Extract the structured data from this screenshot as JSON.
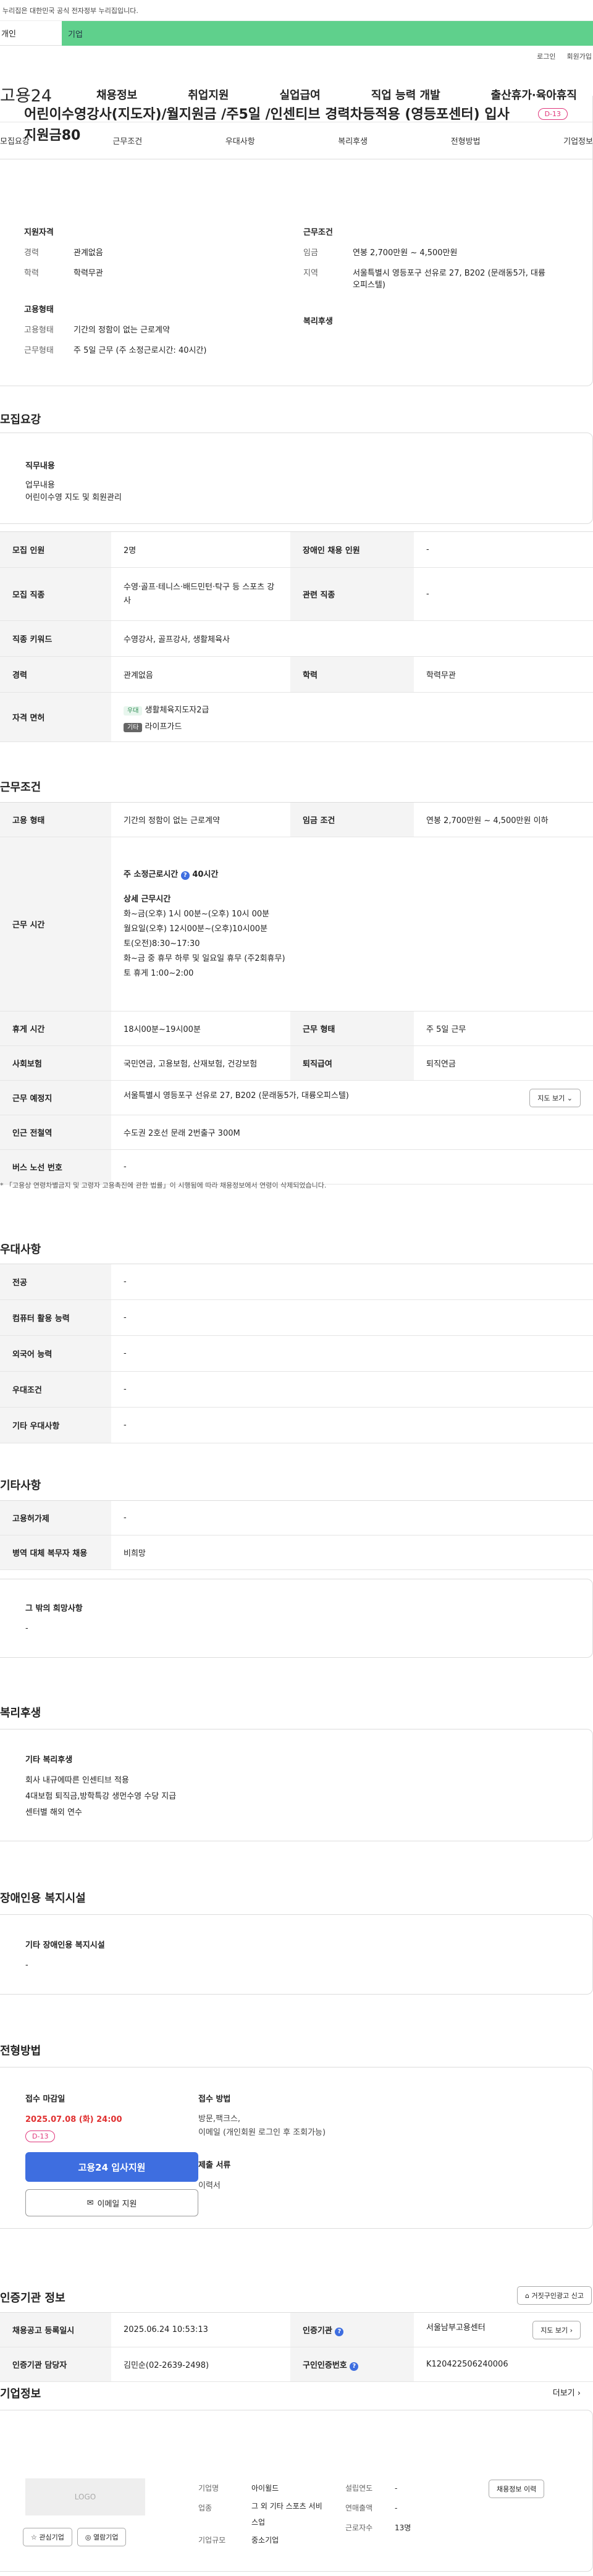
{
  "banner": "이 누리집은 대한민국 공식 전자정부 누리집입니다.",
  "banner_shown": "누리집은 대한민국 공식 전자정부 누리집입니다.",
  "topbar": {
    "tab1": "개인",
    "tab2": "기업"
  },
  "util": {
    "login": "로그인",
    "signup": "회원가입"
  },
  "gnb": {
    "logo": "고용24",
    "menus": [
      "채용정보",
      "취업지원",
      "실업급여",
      "직업 능력 개발",
      "출산휴가·육아휴직"
    ]
  },
  "tabs": [
    "모집요강",
    "근무조건",
    "우대사항",
    "복리후생",
    "전형방법",
    "기업정보"
  ],
  "header": {
    "title": "어린이수영강사(지도자)/월지원금 /주5일 /인센티브 경력차등적용 (영등포센터) 입사지원금80",
    "dday": "D-13",
    "left_h1": "지원자격",
    "career_k": "경력",
    "career_v": "관계없음",
    "edu_k": "학력",
    "edu_v": "학력무관",
    "left_h2": "고용형태",
    "emp_k": "고용형태",
    "emp_v": "기간의 정함이 없는 근로계약",
    "work_k": "근무형태",
    "work_v": "주 5일 근무 (주 소정근로시간: 40시간)",
    "right_h1": "근무조건",
    "wage_k": "임금",
    "wage_v": "연봉 2,700만원 ~ 4,500만원",
    "loc_k": "지역",
    "loc_v": "서울특별시 영등포구 선유로 27, B202 (문래동5가, 대륭오피스텔)",
    "right_h2": "복리후생"
  },
  "recruit": {
    "heading": "모집요강",
    "duty_h": "직무내용",
    "duty_lines": [
      "업무내용",
      "어린이수영 지도 및 회원관리"
    ],
    "rows": [
      {
        "k": "모집 인원",
        "v": "2명",
        "k2": "장애인 채용 인원",
        "v2": "-"
      },
      {
        "k": "모집 직종",
        "v": "수영·골프·테니스·배드민턴·탁구 등 스포츠 강사",
        "k2": "관련 직종",
        "v2": "-"
      },
      {
        "k": "직종 키워드",
        "v": "수영강사, 골프강사, 생활체육사"
      },
      {
        "k": "경력",
        "v": "관계없음",
        "k2": "학력",
        "v2": "학력무관"
      }
    ],
    "license_k": "자격 면허",
    "lic1_tag": "우대",
    "lic1": "생활체육지도자2급",
    "lic2_tag": "기타",
    "lic2": "라이프가드"
  },
  "cond": {
    "heading": "근무조건",
    "emp_k": "고용 형태",
    "emp_v": "기간의 정함이 없는 근로계약",
    "wage_k": "임금 조건",
    "wage_v": "연봉 2,700만원 ~ 4,500만원 이하",
    "time_k": "근무 시간",
    "time_week": "주 소정근로시간",
    "time_week_v": "40시간",
    "time_detail_h": "상세 근무시간",
    "time_lines": [
      "화~금(오후) 1시 00분~(오후) 10시 00분",
      "월요일(오후) 12시00분~(오후)10시00분",
      "토(오전)8:30~17:30",
      "화~금 중 휴무 하루 및 일요일 휴무 (주2회휴무)",
      "토 휴게  1:00~2:00"
    ],
    "break_k": "휴게 시간",
    "break_v": "18시00분~19시00분",
    "form_k": "근무 형태",
    "form_v": "주 5일 근무",
    "ins_k": "사회보험",
    "ins_v": "국민연금, 고용보험, 산재보험, 건강보험",
    "ret_k": "퇴직급여",
    "ret_v": "퇴직연금",
    "place_k": "근무 예정지",
    "place_v": "서울특별시 영등포구 선유로 27, B202 (문래동5가, 대륭오피스텔)",
    "map_btn": "지도 보기",
    "subway_k": "인근 전철역",
    "subway_v": "수도권 2호선 문래 2번출구 300M",
    "bus_k": "버스 노선 번호",
    "bus_v": "-",
    "note": "* 「고용상 연령차별금지 및 고령자 고용촉진에 관한 법률」이 시행됨에 따라 채용정보에서 연령이 삭제되었습니다."
  },
  "pref": {
    "heading": "우대사항",
    "rows": [
      {
        "k": "전공",
        "v": "-"
      },
      {
        "k": "컴퓨터 활용 능력",
        "v": "-"
      },
      {
        "k": "외국어 능력",
        "v": "-"
      },
      {
        "k": "우대조건",
        "v": "-"
      },
      {
        "k": "기타 우대사항",
        "v": "-"
      }
    ]
  },
  "etc": {
    "heading": "기타사항",
    "rows": [
      {
        "k": "고용허가제",
        "v": "-"
      },
      {
        "k": "병역 대체 복무자 채용",
        "v": "비희망"
      }
    ],
    "other_h": "그 밖의 희망사항",
    "other_v": "-"
  },
  "welfare": {
    "heading": "복리후생",
    "box_h": "기타 복리후생",
    "lines": [
      "회사 내규에따른 인센티브 적용",
      "4대보험 퇴직금,방학특강 생먼수영 수당 지급",
      "센터별 해외 연수"
    ]
  },
  "disabled": {
    "heading": "장애인용 복지시설",
    "box_h": "기타 장애인용 복지시설",
    "v": "-"
  },
  "process": {
    "heading": "전형방법",
    "deadline_h": "접수 마감일",
    "deadline": "2025.07.08 (화) 24:00",
    "dday": "D-13",
    "apply_btn": "고용24 입사지원",
    "email_btn": "이메일 지원",
    "method_h": "접수 방법",
    "method_lines": [
      "방문,팩크스,",
      "이메일 (개인회원 로그인 후 조회가능)"
    ],
    "docs_h": "제출 서류",
    "docs_v": "이력서"
  },
  "agency": {
    "heading": "인증기관 정보",
    "report_btn": "거짓구인광고 신고",
    "reg_k": "채용공고 등록일시",
    "reg_v": "2025.06.24 10:53:13",
    "agency_k": "인증기관",
    "agency_v": "서울남부고용센터",
    "map_btn": "지도 보기",
    "manager_k": "인증기관 담당자",
    "manager_v": "김민순(02-2639-2498)",
    "id_k": "구인인증번호",
    "id_v": "K120422506240006"
  },
  "company": {
    "heading": "기업정보",
    "more": "더보기",
    "logo": "LOGO",
    "fav_btn": "관심기업",
    "visit_btn": "열람기업",
    "name_k": "기업명",
    "name_v": "아이윌드",
    "ind_k": "업종",
    "ind_v": "그 외 기타 스포츠 서비스업",
    "size_k": "기업규모",
    "size_v": "중소기업",
    "year_k": "설립연도",
    "year_v": "-",
    "sales_k": "연매출액",
    "sales_v": "-",
    "emp_k": "근로자수",
    "emp_v": "13명",
    "hist_btn": "채용정보 이력"
  }
}
